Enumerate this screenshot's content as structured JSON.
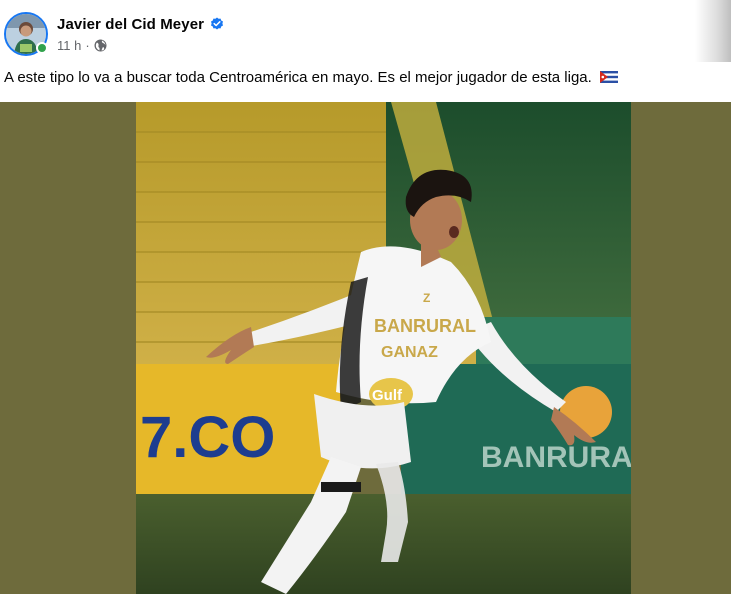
{
  "post": {
    "author": "Javier del Cid Meyer",
    "verified_icon": "verified-badge-icon",
    "time": "11 h",
    "separator": "·",
    "privacy_icon": "globe-icon",
    "text": "A este tipo lo va a buscar toda Centroamérica en mayo. Es el mejor jugador de esta liga.",
    "text_emoji": "flag-cuba-icon"
  },
  "photo": {
    "jersey_sponsor_1": "BANRURAL",
    "jersey_sponsor_2": "GANAZ",
    "jersey_sponsor_3": "Gulf",
    "billboard_left": "7.CO",
    "billboard_right": "BANRURAL",
    "jersey_brand": "Z"
  },
  "colors": {
    "avatar_ring": "#1877f2",
    "online": "#31a24c",
    "meta_text": "#65676b",
    "media_background": "#6e6b3c"
  }
}
